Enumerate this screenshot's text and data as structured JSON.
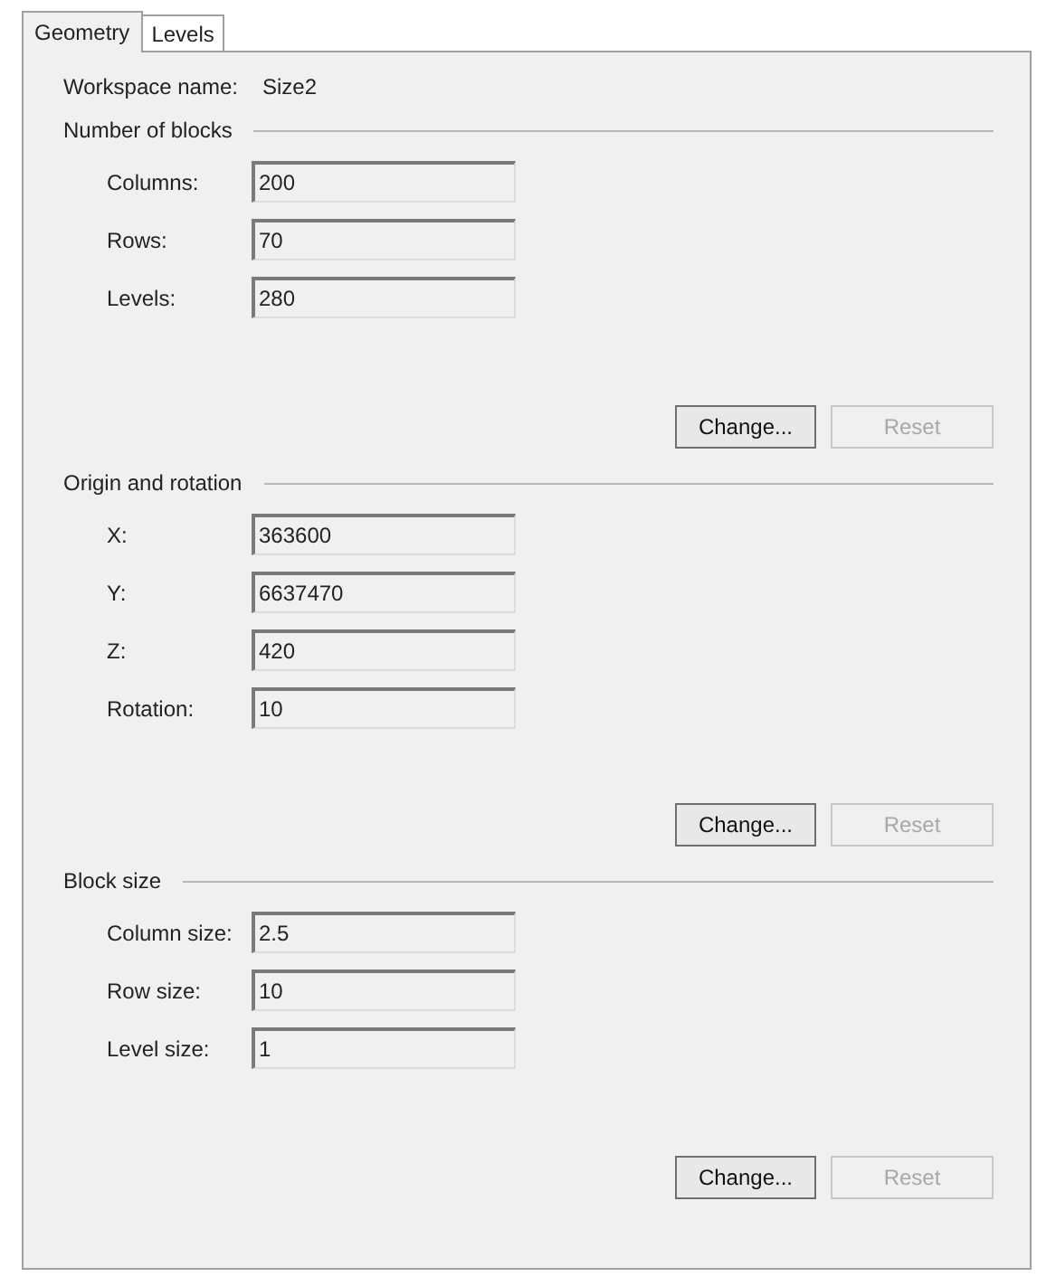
{
  "tabs": [
    {
      "label": "Geometry",
      "selected": true
    },
    {
      "label": "Levels",
      "selected": false
    }
  ],
  "workspace": {
    "label": "Workspace name:",
    "value": "Size2"
  },
  "sections": [
    {
      "title": "Number of blocks",
      "fields": [
        {
          "label": "Columns:",
          "value": "200"
        },
        {
          "label": "Rows:",
          "value": "70"
        },
        {
          "label": "Levels:",
          "value": "280"
        }
      ],
      "buttons": [
        {
          "label": "Change...",
          "disabled": false
        },
        {
          "label": "Reset",
          "disabled": true
        }
      ]
    },
    {
      "title": "Origin and rotation",
      "fields": [
        {
          "label": "X:",
          "value": "363600"
        },
        {
          "label": "Y:",
          "value": "6637470"
        },
        {
          "label": "Z:",
          "value": "420"
        },
        {
          "label": "Rotation:",
          "value": "10"
        }
      ],
      "buttons": [
        {
          "label": "Change...",
          "disabled": false
        },
        {
          "label": "Reset",
          "disabled": true
        }
      ]
    },
    {
      "title": "Block size",
      "fields": [
        {
          "label": "Column size:",
          "value": "2.5"
        },
        {
          "label": "Row size:",
          "value": "10"
        },
        {
          "label": "Level size:",
          "value": "1"
        }
      ],
      "buttons": [
        {
          "label": "Change...",
          "disabled": false
        },
        {
          "label": "Reset",
          "disabled": true
        }
      ]
    }
  ]
}
